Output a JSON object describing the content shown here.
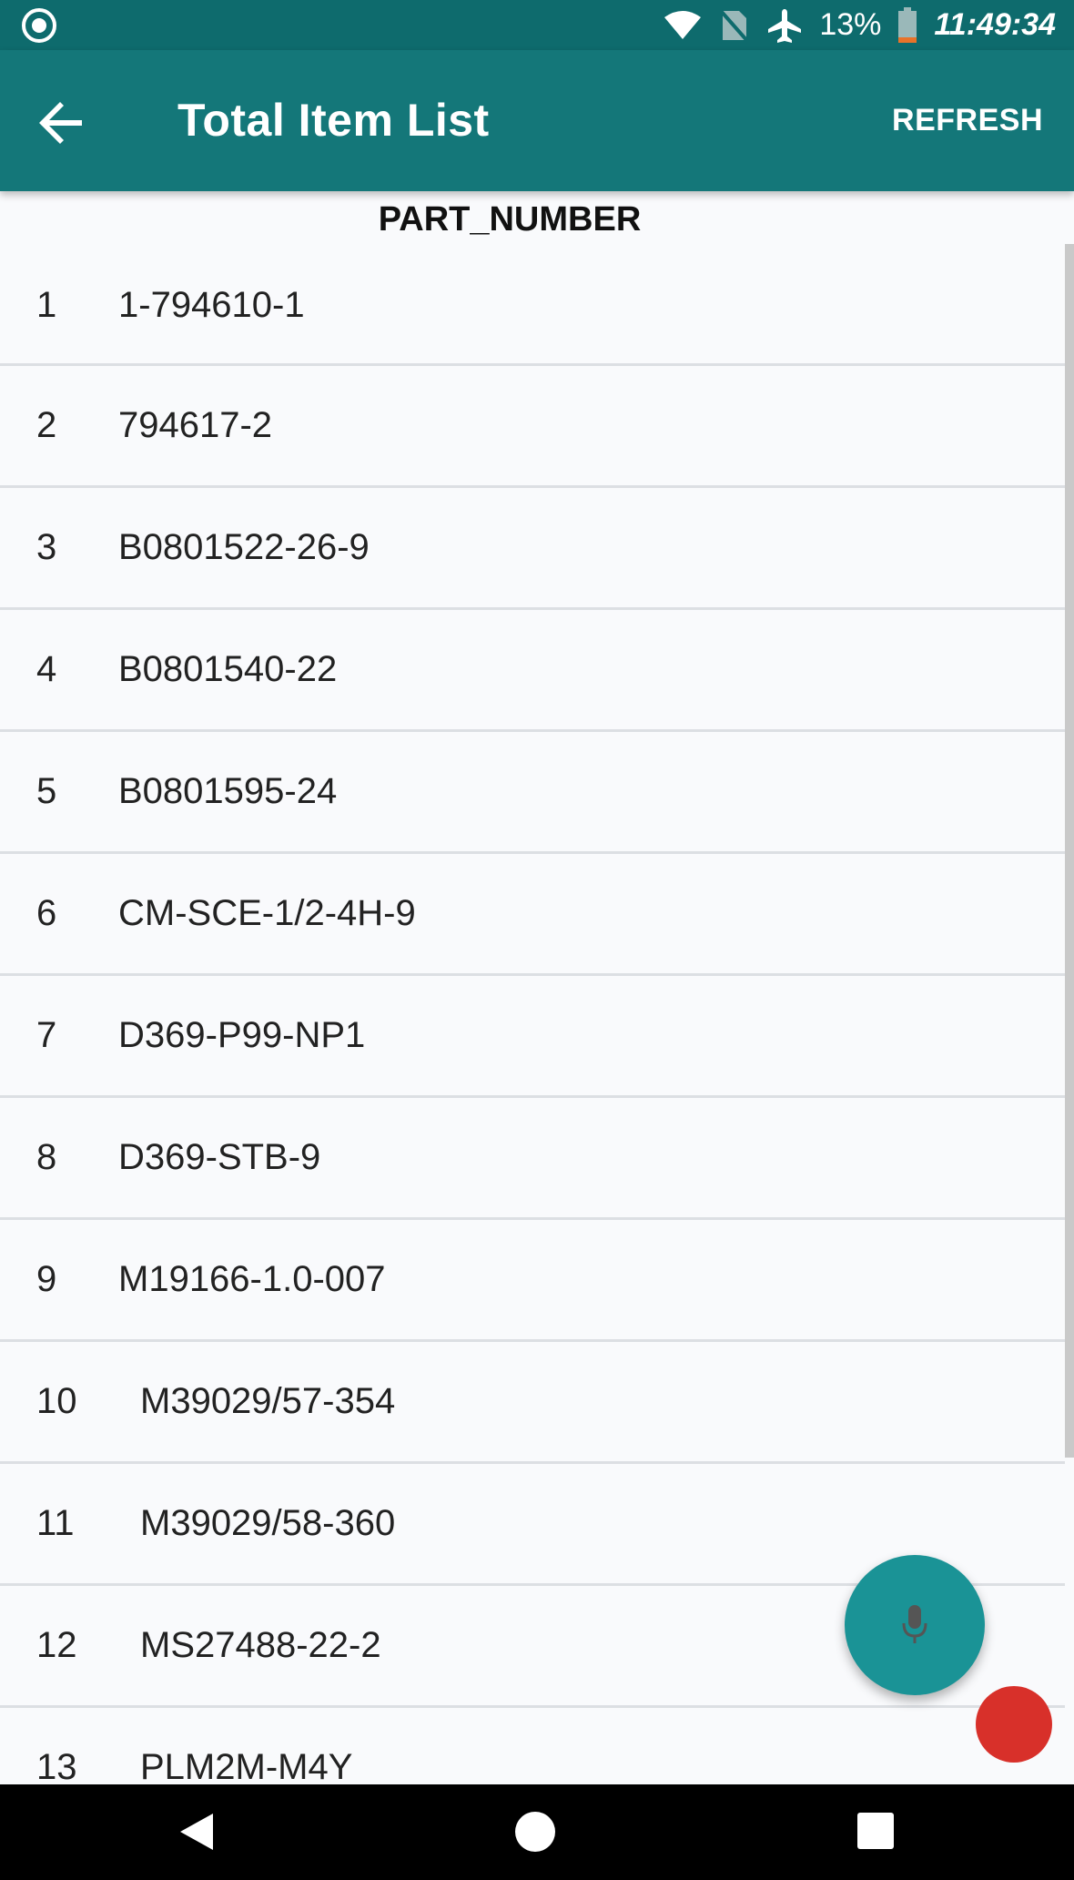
{
  "status_bar": {
    "battery_percent": "13%",
    "clock": "11:49:34",
    "icons": [
      "record-icon",
      "wifi-icon",
      "no-sim-icon",
      "airplane-icon",
      "battery-icon"
    ]
  },
  "app_bar": {
    "title": "Total Item List",
    "refresh_label": "REFRESH"
  },
  "table": {
    "column_header": "PART_NUMBER",
    "rows": [
      {
        "index": "1",
        "part_number": "1-794610-1"
      },
      {
        "index": "2",
        "part_number": "794617-2"
      },
      {
        "index": "3",
        "part_number": "B0801522-26-9"
      },
      {
        "index": "4",
        "part_number": "B0801540-22"
      },
      {
        "index": "5",
        "part_number": "B0801595-24"
      },
      {
        "index": "6",
        "part_number": "CM-SCE-1/2-4H-9"
      },
      {
        "index": "7",
        "part_number": "D369-P99-NP1"
      },
      {
        "index": "8",
        "part_number": "D369-STB-9"
      },
      {
        "index": "9",
        "part_number": "M19166-1.0-007"
      },
      {
        "index": "10",
        "part_number": "M39029/57-354"
      },
      {
        "index": "11",
        "part_number": "M39029/58-360"
      },
      {
        "index": "12",
        "part_number": "MS27488-22-2"
      },
      {
        "index": "13",
        "part_number": "PLM2M-M4Y"
      }
    ]
  },
  "colors": {
    "status_bar": "#0e6b6d",
    "app_bar": "#147779",
    "fab_mic": "#1a9396",
    "fab_red": "#d8302a"
  }
}
